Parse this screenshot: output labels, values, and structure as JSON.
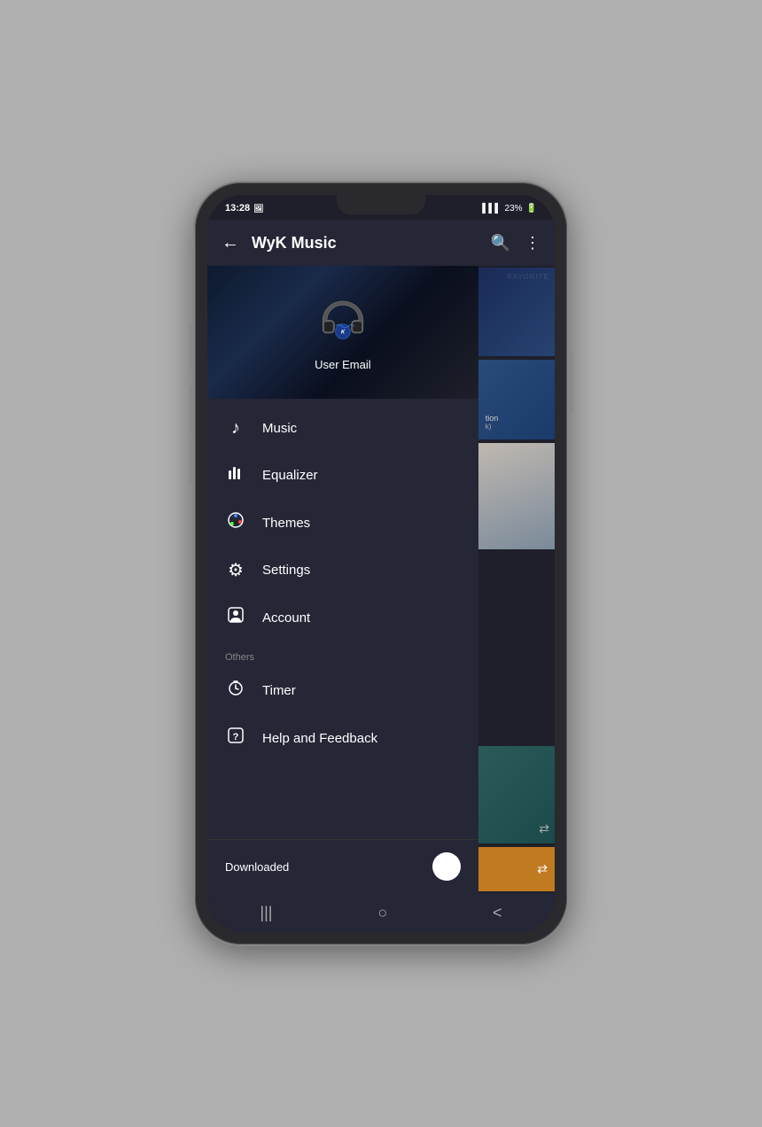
{
  "status_bar": {
    "time": "13:28",
    "battery": "23%"
  },
  "app_bar": {
    "title": "WyK Music",
    "back_label": "←",
    "search_icon": "search",
    "more_icon": "⋮"
  },
  "drawer": {
    "user_email": "User Email",
    "menu_items": [
      {
        "id": "music",
        "label": "Music",
        "icon": "music-note"
      },
      {
        "id": "equalizer",
        "label": "Equalizer",
        "icon": "equalizer"
      },
      {
        "id": "themes",
        "label": "Themes",
        "icon": "palette"
      },
      {
        "id": "settings",
        "label": "Settings",
        "icon": "settings"
      },
      {
        "id": "account",
        "label": "Account",
        "icon": "account"
      }
    ],
    "section_others": "Others",
    "others_items": [
      {
        "id": "timer",
        "label": "Timer",
        "icon": "timer"
      },
      {
        "id": "help",
        "label": "Help and Feedback",
        "icon": "help"
      }
    ],
    "bottom": {
      "label": "Downloaded",
      "toggle": false
    }
  },
  "nav_bar": {
    "recent_icon": "|||",
    "home_icon": "○",
    "back_icon": "<"
  }
}
